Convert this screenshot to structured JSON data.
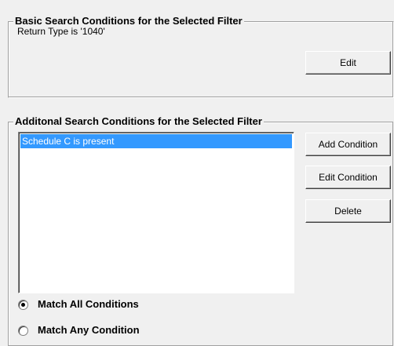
{
  "basic_section": {
    "title": "Basic Search Conditions for the Selected Filter",
    "condition_text": "Return Type is '1040'",
    "edit_label": "Edit"
  },
  "additional_section": {
    "title": "Additonal Search Conditions for the Selected Filter",
    "conditions": [
      {
        "label": "Schedule C is present",
        "selected": true
      }
    ],
    "buttons": {
      "add_label": "Add Condition",
      "edit_label": "Edit Condition",
      "delete_label": "Delete"
    },
    "match_options": [
      {
        "label": "Match All Conditions",
        "checked": true
      },
      {
        "label": "Match Any Condition",
        "checked": false
      }
    ]
  }
}
